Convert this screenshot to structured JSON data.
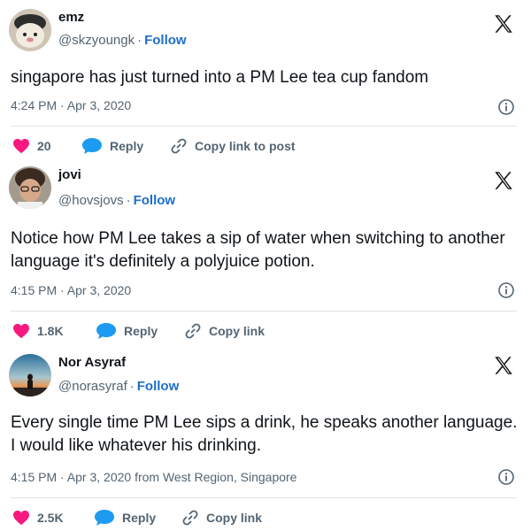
{
  "tweets": [
    {
      "name": "emz",
      "handle": "@skzyoungk",
      "follow": "Follow",
      "text": "singapore has just turned into a PM Lee tea cup fandom",
      "timestamp": "4:24 PM · Apr 3, 2020",
      "likes": "20",
      "reply": "Reply",
      "copy": "Copy link to post"
    },
    {
      "name": "jovi",
      "handle": "@hovsjovs",
      "follow": "Follow",
      "text": "Notice how PM Lee takes a sip of water when switching to another language it's definitely a polyjuice potion.",
      "timestamp": "4:15 PM · Apr 3, 2020",
      "likes": "1.8K",
      "reply": "Reply",
      "copy": "Copy link"
    },
    {
      "name": "Nor Asyraf",
      "handle": "@norasyraf",
      "follow": "Follow",
      "text": "Every single time PM Lee sips a drink, he speaks another language. I would like whatever his drinking.",
      "timestamp": "4:15 PM · Apr 3, 2020 from West Region, Singapore",
      "likes": "2.5K",
      "reply": "Reply",
      "copy": "Copy link"
    }
  ],
  "colors": {
    "heart": "#f91880",
    "reply_bubble": "#1d9bf0",
    "follow": "#1d6fc9",
    "muted": "#536471"
  }
}
